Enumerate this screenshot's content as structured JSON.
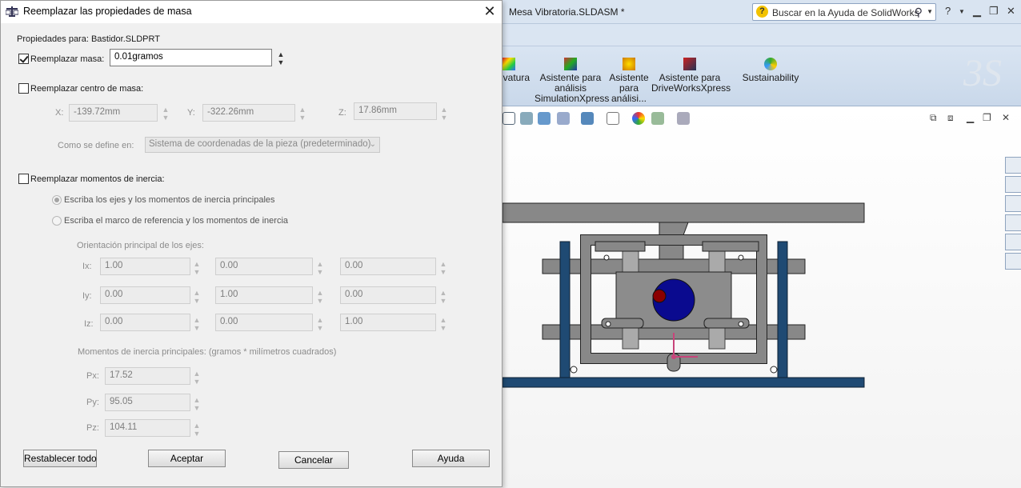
{
  "app": {
    "window_title": "Mesa Vibratoria.SLDASM *",
    "search_placeholder": "Buscar en la Ayuda de SolidWorks",
    "ribbon": [
      {
        "label": "vatura"
      },
      {
        "label": "Asistente para análisis SimulationXpress"
      },
      {
        "label": "Asistente para análisi..."
      },
      {
        "label": "Asistente para DriveWorksXpress"
      },
      {
        "label": "Sustainability"
      }
    ],
    "colors": {
      "frame": "#1f4a73",
      "part_gray": "#8a8a8a",
      "bore": "#0a0a8f",
      "pin": "#8b0000",
      "triad": "#c8447a"
    }
  },
  "dialog": {
    "title": "Reemplazar las propiedades de masa",
    "props_for": "Propiedades para: Bastidor.SLDPRT",
    "mass": {
      "label": "Reemplazar masa:",
      "checked": true,
      "value": "0.01gramos"
    },
    "center": {
      "label": "Reemplazar centro de masa:",
      "checked": false,
      "x_label": "X:",
      "x": "-139.72mm",
      "y_label": "Y:",
      "y": "-322.26mm",
      "z_label": "Z:",
      "z": "17.86mm",
      "defined_in_label": "Como se define en:",
      "defined_in_value": "Sistema de coordenadas de la pieza (predeterminado)"
    },
    "inertia": {
      "label": "Reemplazar momentos de inercia:",
      "checked": false,
      "opt1": "Escriba los ejes y los momentos de inercia principales",
      "opt2": "Escriba el marco de referencia y los momentos de inercia",
      "orientation_label": "Orientación principal de los ejes:",
      "rows": [
        {
          "label": "Ix:",
          "values": [
            "1.00",
            "0.00",
            "0.00"
          ]
        },
        {
          "label": "Iy:",
          "values": [
            "0.00",
            "1.00",
            "0.00"
          ]
        },
        {
          "label": "Iz:",
          "values": [
            "0.00",
            "0.00",
            "1.00"
          ]
        }
      ],
      "principal_label": "Momentos de inercia principales: (gramos *  milímetros cuadrados)",
      "px_label": "Px:",
      "px": "17.52",
      "py_label": "Py:",
      "py": "95.05",
      "pz_label": "Pz:",
      "pz": "104.11"
    },
    "buttons": {
      "reset": "Restablecer todo",
      "ok": "Aceptar",
      "cancel": "Cancelar",
      "help": "Ayuda"
    }
  }
}
